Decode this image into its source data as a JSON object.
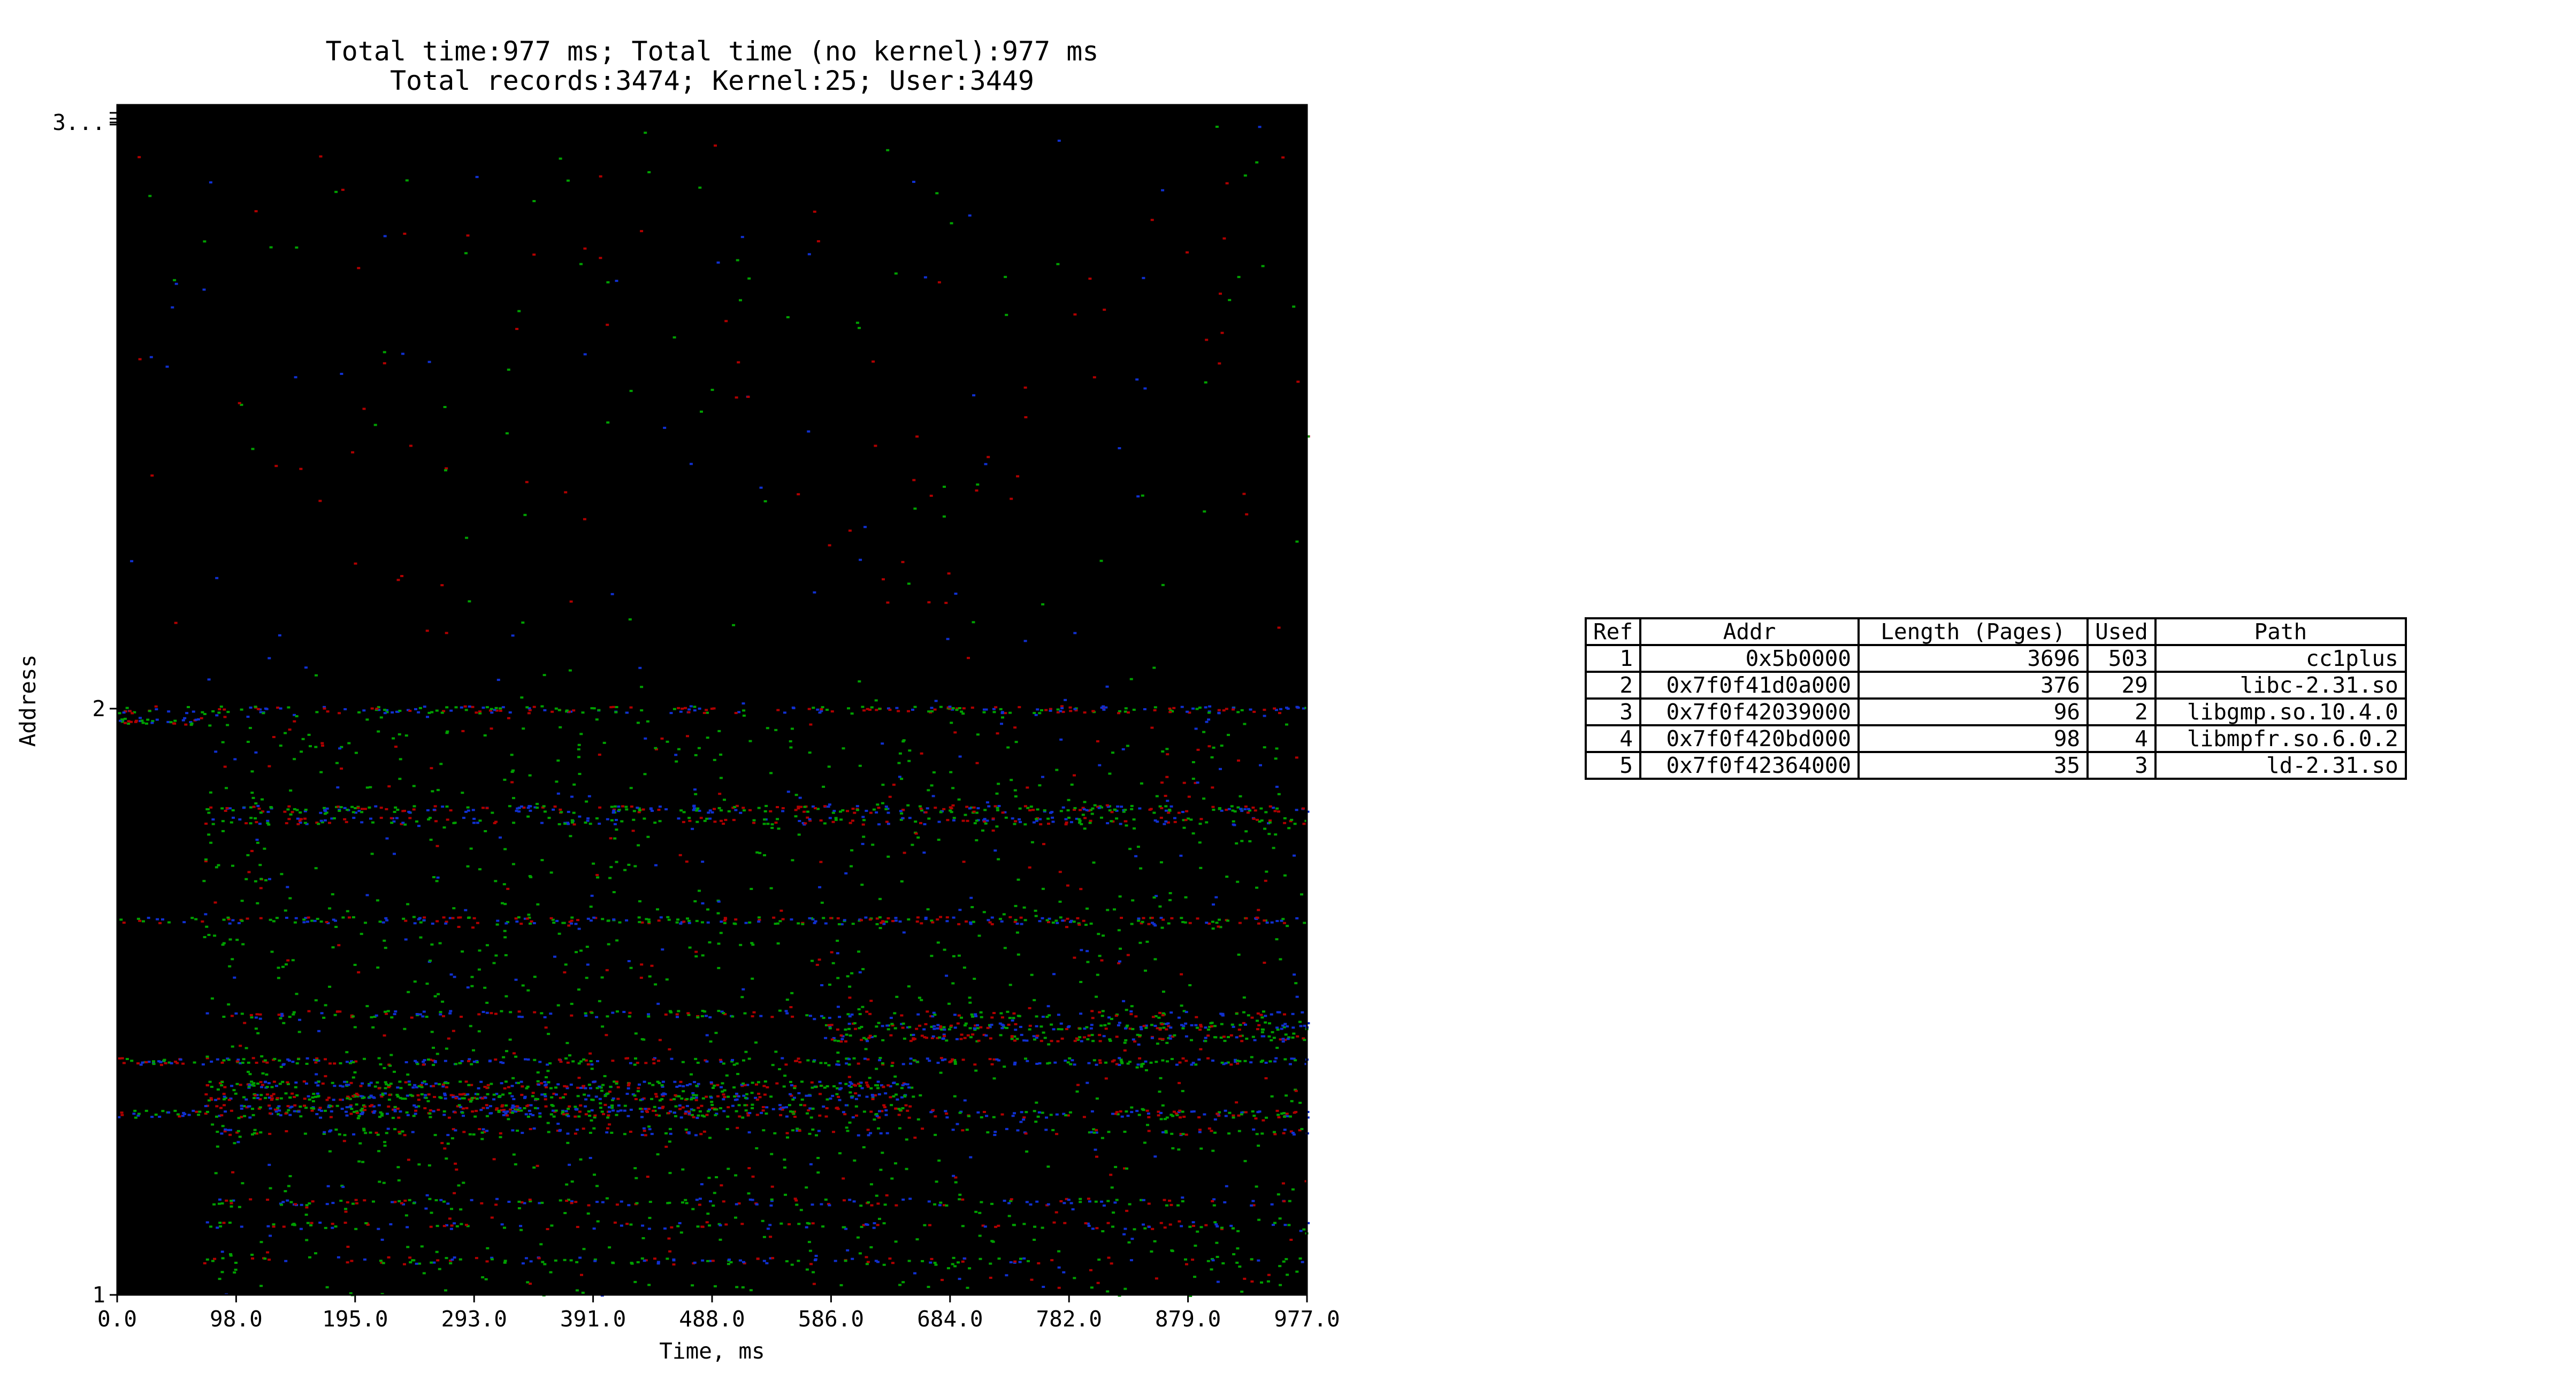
{
  "chart_data": {
    "type": "heatmap",
    "title": [
      "Total time:977 ms; Total time (no kernel):977 ms",
      "Total records:3474; Kernel:25; User:3449"
    ],
    "xlabel": "Time, ms",
    "ylabel": "Address",
    "xlim": [
      0,
      977
    ],
    "xticks": [
      "0.0",
      "98.0",
      "195.0",
      "293.0",
      "391.0",
      "488.0",
      "586.0",
      "684.0",
      "782.0",
      "879.0",
      "977.0"
    ],
    "yticks": [
      {
        "label": "1",
        "value": 1
      },
      {
        "label": "2",
        "value": 2
      },
      {
        "label": "3...",
        "value": 3
      }
    ],
    "background": "#000000",
    "point_colors": [
      "#00a000",
      "#b00000",
      "#1030d0"
    ],
    "activity_bands": [
      {
        "y": 2.0,
        "x": [
          0,
          977
        ],
        "density": 0.5
      },
      {
        "y": 1.98,
        "x": [
          0,
          70
        ],
        "density": 0.9
      },
      {
        "y": 1.83,
        "x": [
          70,
          977
        ],
        "density": 0.6
      },
      {
        "y": 1.81,
        "x": [
          70,
          977
        ],
        "density": 0.4
      },
      {
        "y": 1.64,
        "x": [
          0,
          977
        ],
        "density": 0.5
      },
      {
        "y": 1.48,
        "x": [
          70,
          977
        ],
        "density": 0.35
      },
      {
        "y": 1.46,
        "x": [
          580,
          977
        ],
        "density": 0.7
      },
      {
        "y": 1.44,
        "x": [
          580,
          977
        ],
        "density": 0.6
      },
      {
        "y": 1.4,
        "x": [
          0,
          977
        ],
        "density": 0.5
      },
      {
        "y": 1.36,
        "x": [
          70,
          655
        ],
        "density": 0.8
      },
      {
        "y": 1.34,
        "x": [
          70,
          655
        ],
        "density": 0.8
      },
      {
        "y": 1.32,
        "x": [
          70,
          655
        ],
        "density": 0.7
      },
      {
        "y": 1.31,
        "x": [
          0,
          977
        ],
        "density": 0.5
      },
      {
        "y": 1.28,
        "x": [
          70,
          977
        ],
        "density": 0.3
      },
      {
        "y": 1.16,
        "x": [
          70,
          977
        ],
        "density": 0.3
      },
      {
        "y": 1.12,
        "x": [
          70,
          977
        ],
        "density": 0.25
      },
      {
        "y": 1.06,
        "x": [
          70,
          977
        ],
        "density": 0.25
      }
    ]
  },
  "table": {
    "columns": [
      "Ref",
      "Addr",
      "Length (Pages)",
      "Used",
      "Path"
    ],
    "rows": [
      [
        "1",
        "0x5b0000",
        "3696",
        "503",
        "cc1plus"
      ],
      [
        "2",
        "0x7f0f41d0a000",
        "376",
        "29",
        "libc-2.31.so"
      ],
      [
        "3",
        "0x7f0f42039000",
        "96",
        "2",
        "libgmp.so.10.4.0"
      ],
      [
        "4",
        "0x7f0f420bd000",
        "98",
        "4",
        "libmpfr.so.6.0.2"
      ],
      [
        "5",
        "0x7f0f42364000",
        "35",
        "3",
        "ld-2.31.so"
      ]
    ]
  }
}
